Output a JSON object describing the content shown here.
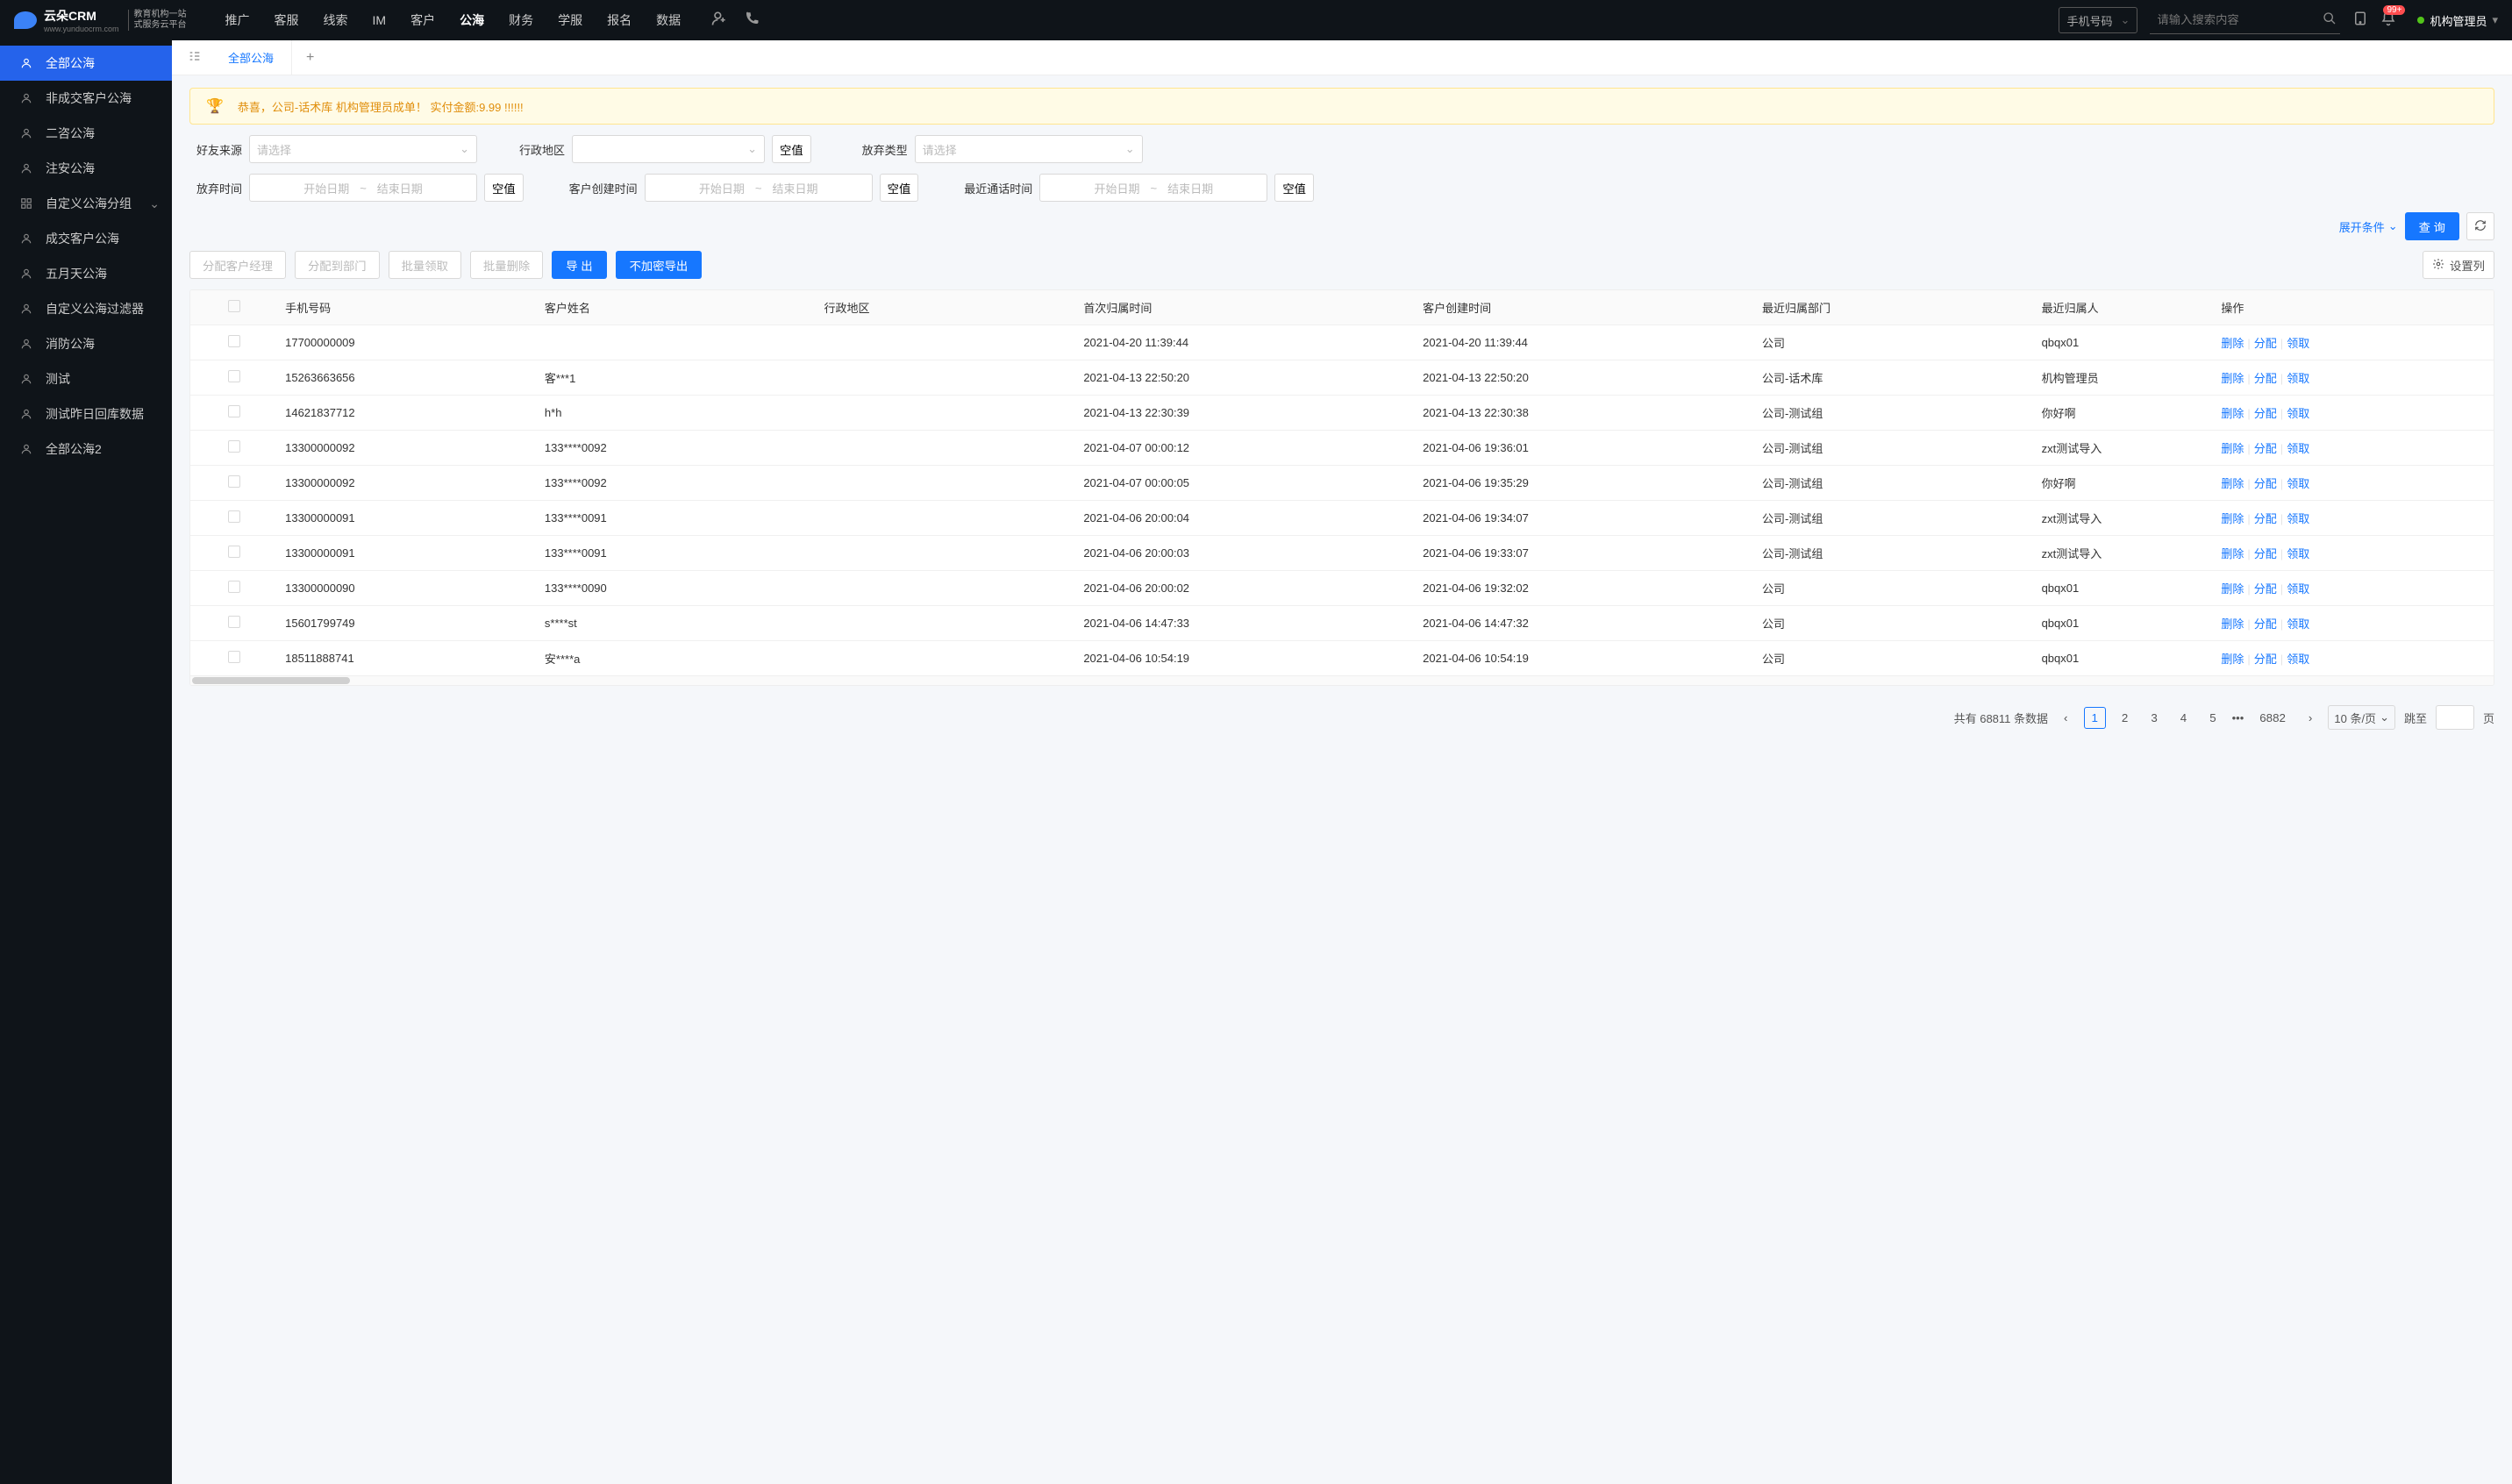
{
  "header": {
    "logo": "云朵CRM",
    "logo_site": "www.yunduocrm.com",
    "logo_sub1": "教育机构一站",
    "logo_sub2": "式服务云平台",
    "nav": [
      "推广",
      "客服",
      "线索",
      "IM",
      "客户",
      "公海",
      "财务",
      "学服",
      "报名",
      "数据"
    ],
    "nav_active_index": 5,
    "search_type": "手机号码",
    "search_placeholder": "请输入搜索内容",
    "badge": "99+",
    "user": "机构管理员"
  },
  "sidebar": {
    "items": [
      {
        "label": "全部公海",
        "active": true
      },
      {
        "label": "非成交客户公海"
      },
      {
        "label": "二咨公海"
      },
      {
        "label": "注安公海"
      },
      {
        "label": "自定义公海分组",
        "chevron": true
      },
      {
        "label": "成交客户公海"
      },
      {
        "label": "五月天公海"
      },
      {
        "label": "自定义公海过滤器"
      },
      {
        "label": "消防公海"
      },
      {
        "label": "测试"
      },
      {
        "label": "测试昨日回库数据"
      },
      {
        "label": "全部公海2"
      }
    ]
  },
  "tabs": {
    "tab0": "全部公海"
  },
  "banner": {
    "text": "恭喜，公司-话术库  机构管理员成单！  实付金额:9.99 !!!!!!"
  },
  "filters": {
    "source_label": "好友来源",
    "placeholder_select": "请选择",
    "region_label": "行政地区",
    "null_btn": "空值",
    "abandon_type_label": "放弃类型",
    "abandon_time_label": "放弃时间",
    "create_time_label": "客户创建时间",
    "last_call_label": "最近通话时间",
    "start_date": "开始日期",
    "end_date": "结束日期",
    "expand": "展开条件",
    "search": "查 询"
  },
  "toolbar": {
    "assign_mgr": "分配客户经理",
    "assign_dept": "分配到部门",
    "batch_claim": "批量领取",
    "batch_delete": "批量删除",
    "export": "导 出",
    "export_plain": "不加密导出",
    "set_columns": "设置列"
  },
  "table": {
    "columns": [
      "手机号码",
      "客户姓名",
      "行政地区",
      "首次归属时间",
      "客户创建时间",
      "最近归属部门",
      "最近归属人",
      "操作"
    ],
    "op": {
      "delete": "删除",
      "assign": "分配",
      "claim": "领取"
    },
    "rows": [
      {
        "phone": "17700000009",
        "name": "",
        "region": "",
        "first": "2021-04-20 11:39:44",
        "create": "2021-04-20 11:39:44",
        "dept": "公司",
        "owner": "qbqx01"
      },
      {
        "phone": "15263663656",
        "name": "客***1",
        "region": "",
        "first": "2021-04-13 22:50:20",
        "create": "2021-04-13 22:50:20",
        "dept": "公司-话术库",
        "owner": "机构管理员"
      },
      {
        "phone": "14621837712",
        "name": "h*h",
        "region": "",
        "first": "2021-04-13 22:30:39",
        "create": "2021-04-13 22:30:38",
        "dept": "公司-测试组",
        "owner": "你好啊"
      },
      {
        "phone": "13300000092",
        "name": "133****0092",
        "region": "",
        "first": "2021-04-07 00:00:12",
        "create": "2021-04-06 19:36:01",
        "dept": "公司-测试组",
        "owner": "zxt测试导入"
      },
      {
        "phone": "13300000092",
        "name": "133****0092",
        "region": "",
        "first": "2021-04-07 00:00:05",
        "create": "2021-04-06 19:35:29",
        "dept": "公司-测试组",
        "owner": "你好啊"
      },
      {
        "phone": "13300000091",
        "name": "133****0091",
        "region": "",
        "first": "2021-04-06 20:00:04",
        "create": "2021-04-06 19:34:07",
        "dept": "公司-测试组",
        "owner": "zxt测试导入"
      },
      {
        "phone": "13300000091",
        "name": "133****0091",
        "region": "",
        "first": "2021-04-06 20:00:03",
        "create": "2021-04-06 19:33:07",
        "dept": "公司-测试组",
        "owner": "zxt测试导入"
      },
      {
        "phone": "13300000090",
        "name": "133****0090",
        "region": "",
        "first": "2021-04-06 20:00:02",
        "create": "2021-04-06 19:32:02",
        "dept": "公司",
        "owner": "qbqx01"
      },
      {
        "phone": "15601799749",
        "name": "s****st",
        "region": "",
        "first": "2021-04-06 14:47:33",
        "create": "2021-04-06 14:47:32",
        "dept": "公司",
        "owner": "qbqx01"
      },
      {
        "phone": "18511888741",
        "name": "安****a",
        "region": "",
        "first": "2021-04-06 10:54:19",
        "create": "2021-04-06 10:54:19",
        "dept": "公司",
        "owner": "qbqx01"
      }
    ]
  },
  "pager": {
    "total_text_prefix": "共有",
    "total": "68811",
    "total_text_suffix": "条数据",
    "pages": [
      "1",
      "2",
      "3",
      "4",
      "5"
    ],
    "last": "6882",
    "size": "10 条/页",
    "jump_label": "跳至",
    "page_suffix": "页"
  }
}
